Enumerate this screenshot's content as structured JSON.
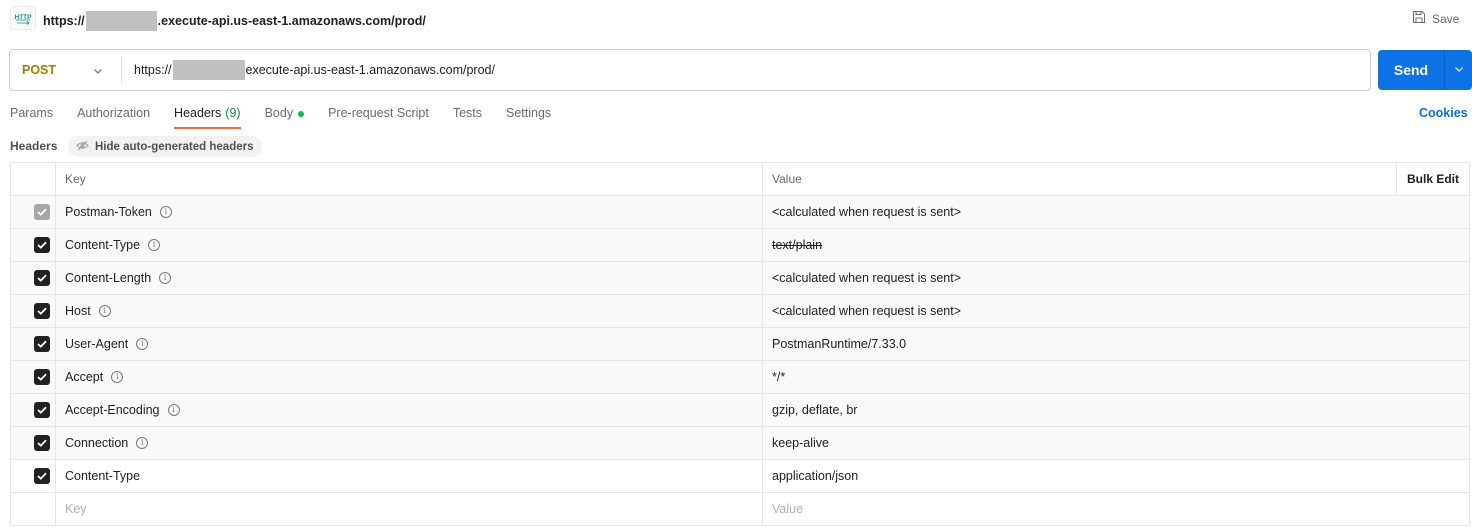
{
  "titlebar": {
    "icon": "http-request-icon",
    "url_prefix": "https://",
    "url_suffix": ".execute-api.us-east-1.amazonaws.com/prod/",
    "save_label": "Save"
  },
  "request": {
    "method": "POST",
    "method_color": "#a37c00",
    "url_prefix": "https://",
    "url_suffix": "execute-api.us-east-1.amazonaws.com/prod/",
    "send_label": "Send",
    "send_color": "#0d72e6"
  },
  "tabs": [
    {
      "label": "Params",
      "active": false
    },
    {
      "label": "Authorization",
      "active": false
    },
    {
      "label": "Headers",
      "count": "(9)",
      "active": true
    },
    {
      "label": "Body",
      "has_indicator": true,
      "active": false
    },
    {
      "label": "Pre-request Script",
      "active": false
    },
    {
      "label": "Tests",
      "active": false
    },
    {
      "label": "Settings",
      "active": false
    }
  ],
  "cookies_label": "Cookies",
  "headers_section": {
    "label": "Headers",
    "hide_auto_label": "Hide auto-generated headers"
  },
  "table": {
    "columns": {
      "key": "Key",
      "value": "Value",
      "bulk_edit": "Bulk Edit"
    },
    "rows": [
      {
        "key": "Postman-Token",
        "value": "<calculated when request is sent>",
        "checked": true,
        "disabled": true,
        "auto": true,
        "info": true,
        "strikethrough": false
      },
      {
        "key": "Content-Type",
        "value": "text/plain",
        "checked": true,
        "disabled": false,
        "auto": true,
        "info": true,
        "strikethrough": true
      },
      {
        "key": "Content-Length",
        "value": "<calculated when request is sent>",
        "checked": true,
        "disabled": false,
        "auto": true,
        "info": true,
        "strikethrough": false
      },
      {
        "key": "Host",
        "value": "<calculated when request is sent>",
        "checked": true,
        "disabled": false,
        "auto": true,
        "info": true,
        "strikethrough": false
      },
      {
        "key": "User-Agent",
        "value": "PostmanRuntime/7.33.0",
        "checked": true,
        "disabled": false,
        "auto": true,
        "info": true,
        "strikethrough": false
      },
      {
        "key": "Accept",
        "value": "*/*",
        "checked": true,
        "disabled": false,
        "auto": true,
        "info": true,
        "strikethrough": false
      },
      {
        "key": "Accept-Encoding",
        "value": "gzip, deflate, br",
        "checked": true,
        "disabled": false,
        "auto": true,
        "info": true,
        "strikethrough": false
      },
      {
        "key": "Connection",
        "value": "keep-alive",
        "checked": true,
        "disabled": false,
        "auto": true,
        "info": true,
        "strikethrough": false
      },
      {
        "key": "Content-Type",
        "value": "application/json",
        "checked": true,
        "disabled": false,
        "auto": false,
        "info": false,
        "strikethrough": false
      }
    ],
    "new_row": {
      "key_placeholder": "Key",
      "value_placeholder": "Value"
    }
  }
}
